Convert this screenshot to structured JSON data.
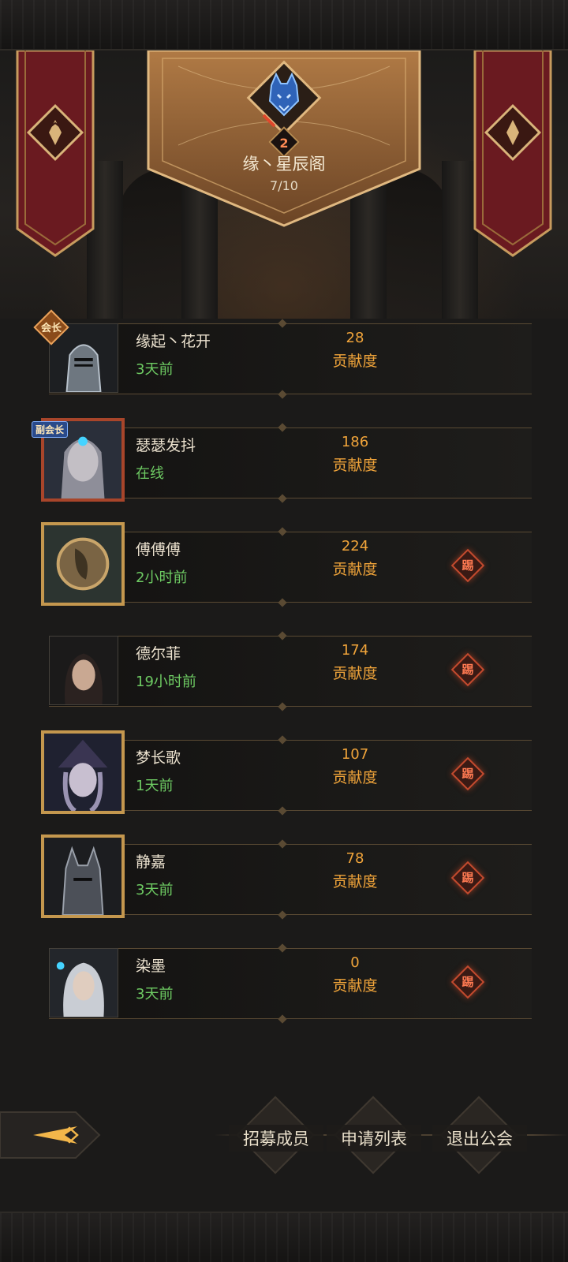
{
  "guild": {
    "name": "缘丶星辰阁",
    "member_count": "7/10",
    "level": "2"
  },
  "members": [
    {
      "name": "缘起丶花开",
      "status": "3天前",
      "contribution": "28",
      "contribution_label": "贡献度",
      "role": "会长",
      "kick": ""
    },
    {
      "name": "瑟瑟发抖",
      "status": "在线",
      "contribution": "186",
      "contribution_label": "贡献度",
      "role": "副会长",
      "kick": ""
    },
    {
      "name": "傅傅傅",
      "status": "2小时前",
      "contribution": "224",
      "contribution_label": "贡献度",
      "role": "",
      "kick": "踢"
    },
    {
      "name": "德尔菲",
      "status": "19小时前",
      "contribution": "174",
      "contribution_label": "贡献度",
      "role": "",
      "kick": "踢"
    },
    {
      "name": "梦长歌",
      "status": "1天前",
      "contribution": "107",
      "contribution_label": "贡献度",
      "role": "",
      "kick": "踢"
    },
    {
      "name": "静嘉",
      "status": "3天前",
      "contribution": "78",
      "contribution_label": "贡献度",
      "role": "",
      "kick": "踢"
    },
    {
      "name": "染墨",
      "status": "3天前",
      "contribution": "0",
      "contribution_label": "贡献度",
      "role": "",
      "kick": "踢"
    }
  ],
  "actions": {
    "recruit": "招募成员",
    "applications": "申请列表",
    "leave": "退出公会"
  },
  "icons": {
    "back": "back-arrow-icon",
    "emblem": "wolf-emblem-icon",
    "banner": "guild-banner-icon",
    "kick": "kick-icon"
  },
  "colors": {
    "accent": "#f0a43a",
    "online": "#6ecb63",
    "kick": "#ff7a52",
    "banner": "#7a1c22"
  }
}
